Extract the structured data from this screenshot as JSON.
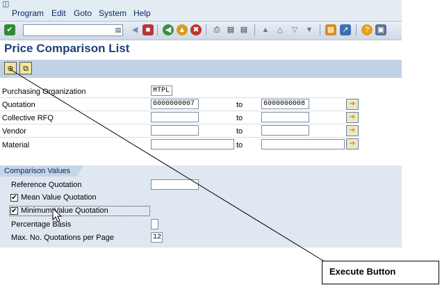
{
  "menu": {
    "items": [
      {
        "label": "Program"
      },
      {
        "label": "Edit"
      },
      {
        "label": "Goto"
      },
      {
        "label": "System"
      },
      {
        "label": "Help"
      }
    ]
  },
  "toolbar": {
    "command_field_value": "",
    "icons": [
      "enter-icon",
      "back-arrow-icon",
      "save-icon",
      "back-icon",
      "exit-icon",
      "cancel-icon",
      "print-icon",
      "find-icon",
      "find-next-icon",
      "first-page-icon",
      "previous-page-icon",
      "next-page-icon",
      "last-page-icon",
      "create-session-icon",
      "shortcut-icon",
      "help-icon",
      "layout-icon"
    ]
  },
  "page": {
    "title": "Price Comparison List"
  },
  "app_toolbar": {
    "icons": [
      "execute-icon",
      "get-variant-icon"
    ]
  },
  "selection": {
    "purch_org": {
      "label": "Purchasing Organization",
      "value": "MTPL"
    },
    "quotation": {
      "label": "Quotation",
      "from": "6000000007",
      "to_label": "to",
      "to": "6000000008"
    },
    "collective_rfq": {
      "label": "Collective RFQ",
      "from": "",
      "to_label": "to",
      "to": ""
    },
    "vendor": {
      "label": "Vendor",
      "from": "",
      "to_label": "to",
      "to": ""
    },
    "material": {
      "label": "Material",
      "from": "",
      "to_label": "to",
      "to": ""
    }
  },
  "comparison": {
    "tab_label": "Comparison Values",
    "reference_quotation": {
      "label": "Reference Quotation",
      "value": ""
    },
    "mean_value": {
      "label": "Mean Value Quotation",
      "checked": true
    },
    "minimum_value": {
      "label": "Minimum Value Quotation",
      "checked": true
    },
    "percentage_basis": {
      "label": "Percentage Basis",
      "value": ""
    },
    "max_quotations": {
      "label": "Max. No. Quotations per Page",
      "value": "12"
    }
  },
  "annotation": {
    "callout_text": "Execute Button"
  },
  "colors": {
    "title": "#20417a",
    "toolbar_bg": "#cfd9e6",
    "app_toolbar_bg": "#c1d2e4",
    "block_bg": "#dfe8f1"
  }
}
